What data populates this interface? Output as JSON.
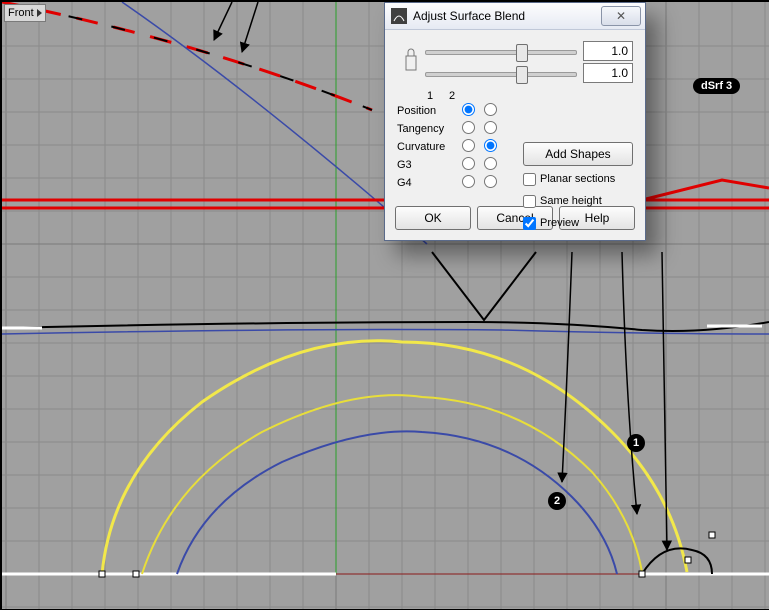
{
  "viewport": {
    "label": "Front"
  },
  "srf_label": "dSrf 3",
  "badges": {
    "one": "1",
    "two": "2"
  },
  "dialog": {
    "title": "Adjust Surface Blend",
    "slider1_value": "1.0",
    "slider2_value": "1.0",
    "col1": "1",
    "col2": "2",
    "rows": {
      "position": "Position",
      "tangency": "Tangency",
      "curvature": "Curvature",
      "g3": "G3",
      "g4": "G4"
    },
    "continuity": {
      "edge1": "Position",
      "edge2": "Curvature"
    },
    "add_shapes": "Add Shapes",
    "planar": "Planar sections",
    "same_height": "Same height",
    "preview": "Preview",
    "preview_checked": true,
    "ok": "OK",
    "cancel": "Cancel",
    "help": "Help"
  }
}
